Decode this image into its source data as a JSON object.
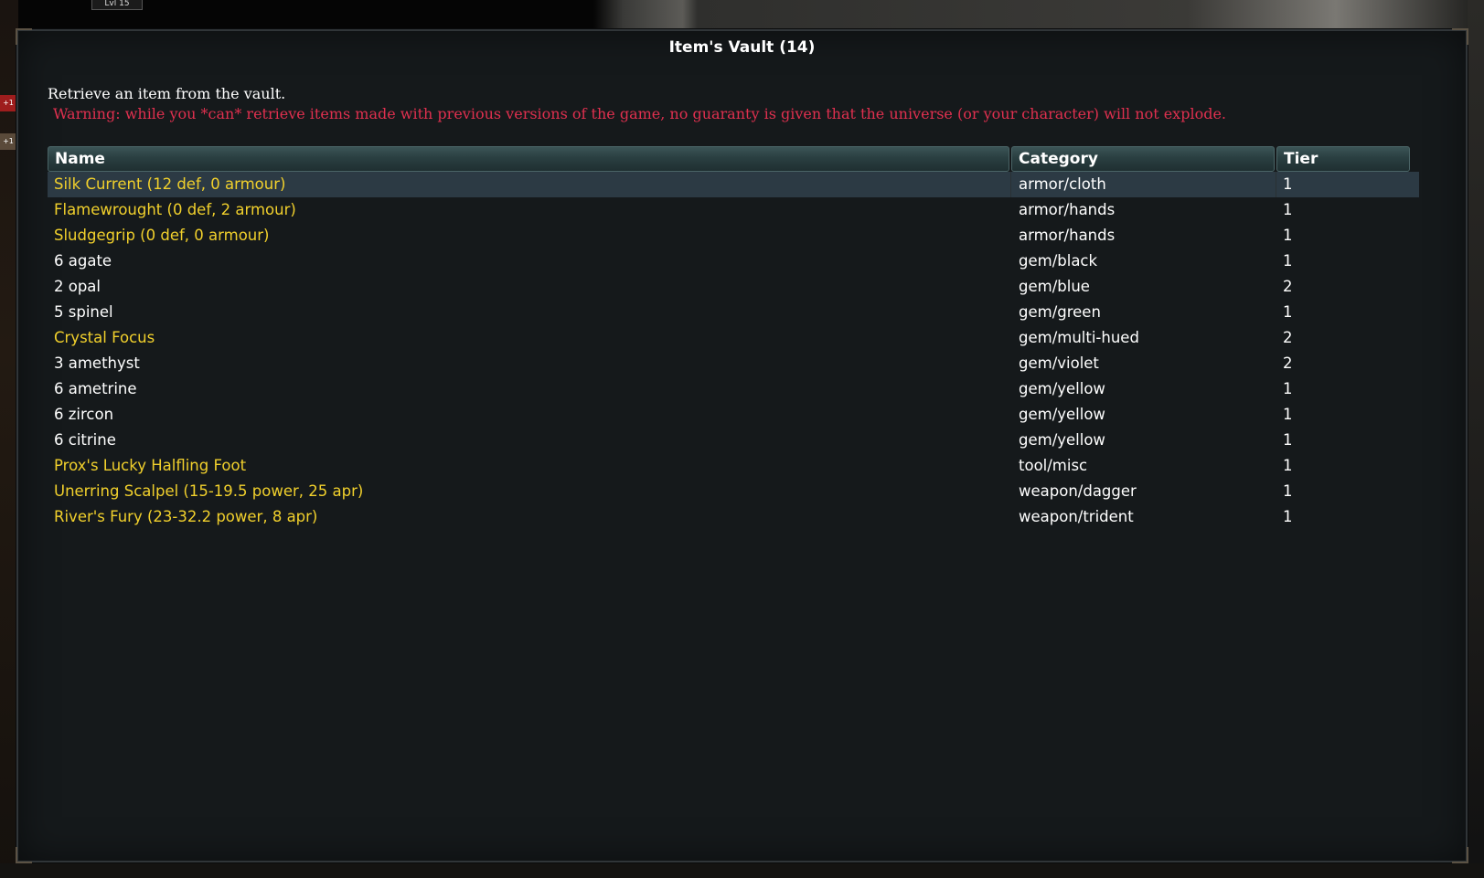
{
  "background": {
    "level_tag": "Lvl 15",
    "badge_red": "+1",
    "badge_brown": "+1"
  },
  "window": {
    "title": "Item's Vault (14)",
    "intro": "Retrieve an item from the vault.",
    "warning": "Warning: while you *can* retrieve items made with previous versions of the game, no guaranty is given that the universe (or your character) will not explode."
  },
  "table": {
    "columns": [
      "Name",
      "Category",
      "Tier"
    ],
    "rows": [
      {
        "name": "Silk Current (12 def, 0 armour)",
        "category": "armor/cloth",
        "tier": "1",
        "color": "#f1d02c",
        "selected": true
      },
      {
        "name": "Flamewrought (0 def, 2 armour)",
        "category": "armor/hands",
        "tier": "1",
        "color": "#f1d02c",
        "selected": false
      },
      {
        "name": "Sludgegrip (0 def, 0 armour)",
        "category": "armor/hands",
        "tier": "1",
        "color": "#f1d02c",
        "selected": false
      },
      {
        "name": "6 agate",
        "category": "gem/black",
        "tier": "1",
        "color": "#ffffff",
        "selected": false
      },
      {
        "name": "2 opal",
        "category": "gem/blue",
        "tier": "2",
        "color": "#ffffff",
        "selected": false
      },
      {
        "name": "5 spinel",
        "category": "gem/green",
        "tier": "1",
        "color": "#ffffff",
        "selected": false
      },
      {
        "name": "Crystal Focus",
        "category": "gem/multi-hued",
        "tier": "2",
        "color": "#f1d02c",
        "selected": false
      },
      {
        "name": "3 amethyst",
        "category": "gem/violet",
        "tier": "2",
        "color": "#ffffff",
        "selected": false
      },
      {
        "name": "6 ametrine",
        "category": "gem/yellow",
        "tier": "1",
        "color": "#ffffff",
        "selected": false
      },
      {
        "name": "6 zircon",
        "category": "gem/yellow",
        "tier": "1",
        "color": "#ffffff",
        "selected": false
      },
      {
        "name": "6 citrine",
        "category": "gem/yellow",
        "tier": "1",
        "color": "#ffffff",
        "selected": false
      },
      {
        "name": "Prox's Lucky Halfling Foot",
        "category": "tool/misc",
        "tier": "1",
        "color": "#f1d02c",
        "selected": false
      },
      {
        "name": "Unerring Scalpel (15-19.5 power, 25 apr)",
        "category": "weapon/dagger",
        "tier": "1",
        "color": "#f1d02c",
        "selected": false
      },
      {
        "name": "River's Fury (23-32.2 power, 8 apr)",
        "category": "weapon/trident",
        "tier": "1",
        "color": "#f1d02c",
        "selected": false
      }
    ]
  },
  "colors": {
    "unique_item": "#f1d02c",
    "normal_item": "#ffffff",
    "warning": "#e0304f",
    "selected_row": "#2c3a44"
  }
}
